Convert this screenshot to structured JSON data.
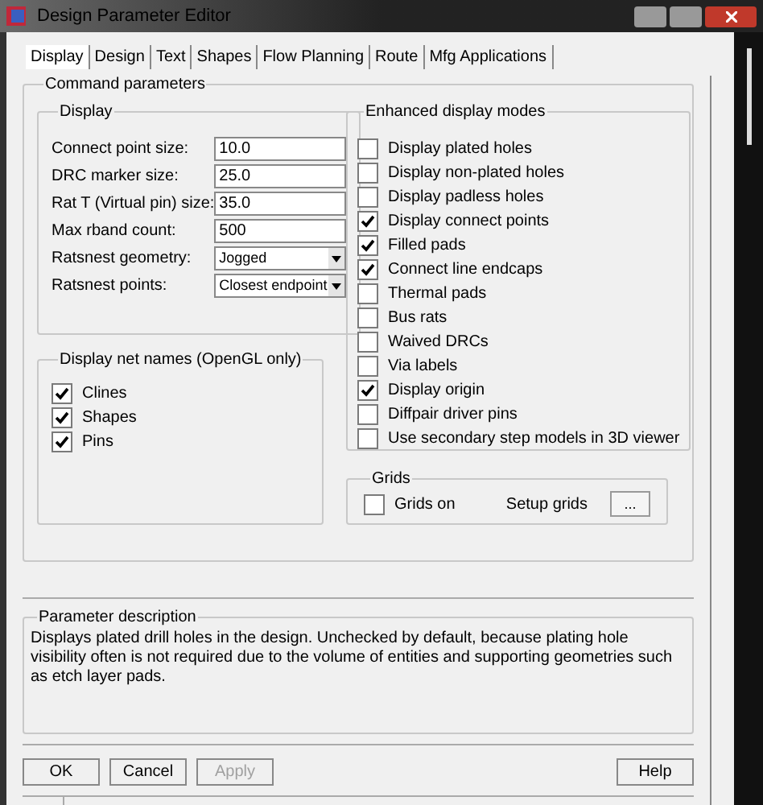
{
  "window": {
    "title": "Design Parameter Editor"
  },
  "tabs": [
    {
      "label": "Display",
      "selected": true
    },
    {
      "label": "Design",
      "selected": false
    },
    {
      "label": "Text",
      "selected": false
    },
    {
      "label": "Shapes",
      "selected": false
    },
    {
      "label": "Flow Planning",
      "selected": false
    },
    {
      "label": "Route",
      "selected": false
    },
    {
      "label": "Mfg Applications",
      "selected": false
    }
  ],
  "command_parameters": {
    "title": "Command parameters",
    "display": {
      "title": "Display",
      "fields": [
        {
          "kind": "text",
          "label": "Connect point size:",
          "value": "10.0"
        },
        {
          "kind": "text",
          "label": "DRC marker size:",
          "value": "25.0"
        },
        {
          "kind": "text",
          "label": "Rat T (Virtual pin) size:",
          "value": "35.0"
        },
        {
          "kind": "text",
          "label": "Max rband count:",
          "value": "500"
        },
        {
          "kind": "dropdown",
          "label": "Ratsnest geometry:",
          "value": "Jogged"
        },
        {
          "kind": "dropdown",
          "label": "Ratsnest points:",
          "value": "Closest endpoint"
        }
      ]
    },
    "net_names": {
      "title": "Display net names (OpenGL only)",
      "items": [
        {
          "label": "Clines",
          "checked": true
        },
        {
          "label": "Shapes",
          "checked": true
        },
        {
          "label": "Pins",
          "checked": true
        }
      ]
    },
    "enhanced": {
      "title": "Enhanced display modes",
      "items": [
        {
          "label": "Display plated holes",
          "checked": false
        },
        {
          "label": "Display non-plated holes",
          "checked": false
        },
        {
          "label": "Display padless holes",
          "checked": false
        },
        {
          "label": "Display connect points",
          "checked": true
        },
        {
          "label": "Filled pads",
          "checked": true
        },
        {
          "label": "Connect line endcaps",
          "checked": true
        },
        {
          "label": "Thermal pads",
          "checked": false
        },
        {
          "label": "Bus rats",
          "checked": false
        },
        {
          "label": "Waived DRCs",
          "checked": false
        },
        {
          "label": "Via labels",
          "checked": false
        },
        {
          "label": "Display origin",
          "checked": true
        },
        {
          "label": "Diffpair driver pins",
          "checked": false
        },
        {
          "label": "Use secondary step models in 3D viewer",
          "checked": false
        }
      ]
    },
    "grids": {
      "title": "Grids",
      "checkbox": {
        "label": "Grids on",
        "checked": false
      },
      "setup_label": "Setup grids",
      "setup_button": "..."
    }
  },
  "parameter_description": {
    "title": "Parameter description",
    "text": "Displays plated drill holes in the design. Unchecked by default, because plating hole visibility often is not required due to the volume of entities and supporting geometries such as etch layer pads."
  },
  "buttons": [
    {
      "label": "OK",
      "disabled": false
    },
    {
      "label": "Cancel",
      "disabled": false
    },
    {
      "label": "Apply",
      "disabled": true
    },
    {
      "label": "Help",
      "disabled": false
    }
  ]
}
